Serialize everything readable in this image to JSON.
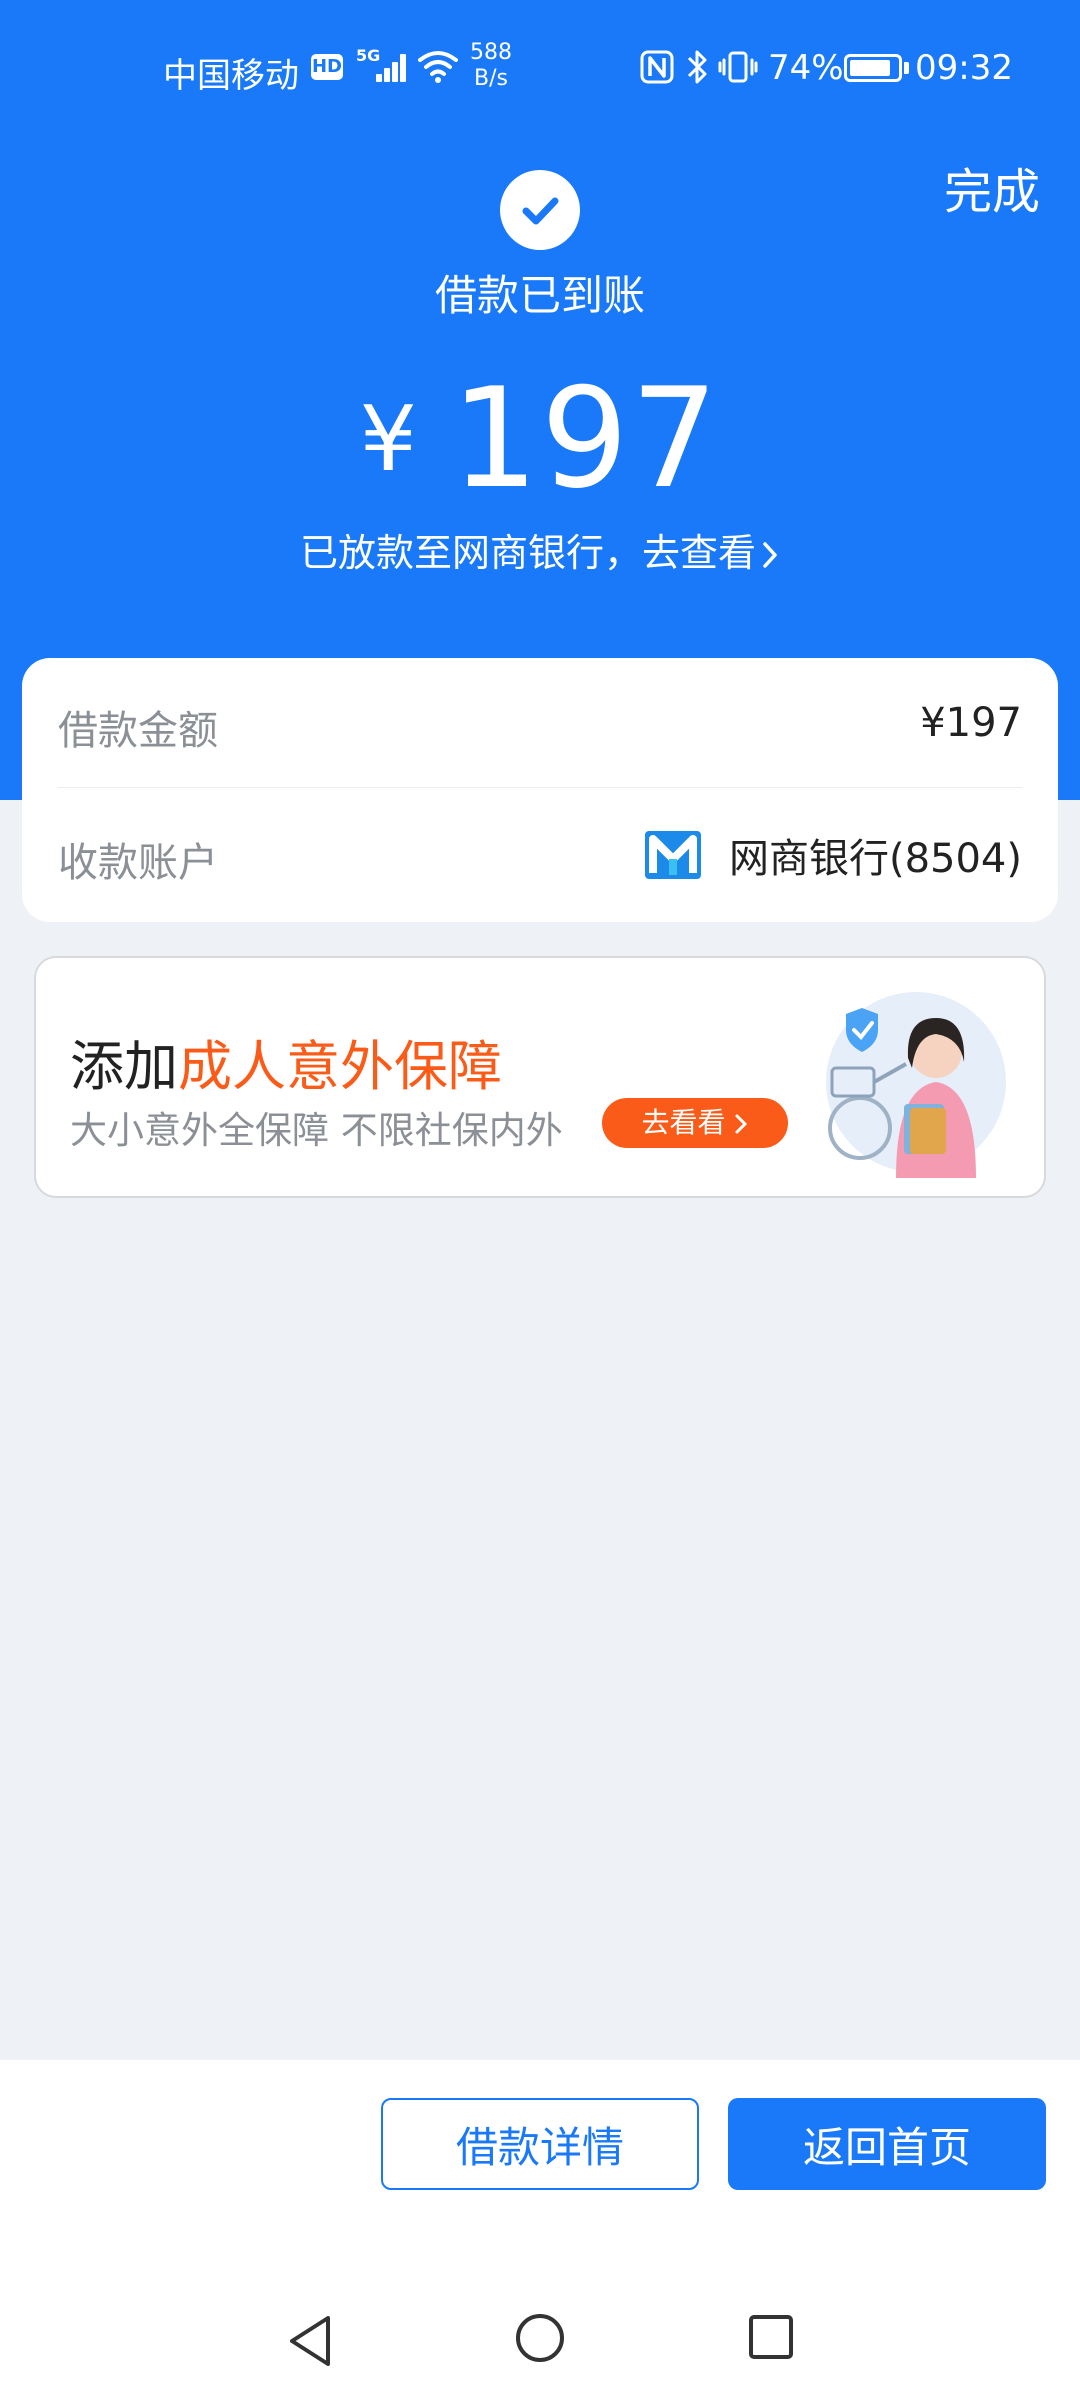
{
  "status_bar": {
    "carrier": "中国移动",
    "hd_badge": "HD",
    "network": "5G",
    "speed_value": "588",
    "speed_unit": "B/s",
    "battery_percent": "74%",
    "time": "09:32"
  },
  "header": {
    "done_label": "完成",
    "status_title": "借款已到账",
    "currency_symbol": "¥",
    "amount": "197",
    "disburse_text": "已放款至网商银行，去查看"
  },
  "info_card": {
    "loan_amount_label": "借款金额",
    "loan_amount_value": "¥197",
    "account_label": "收款账户",
    "account_value": "网商银行(8504)"
  },
  "insurance_banner": {
    "title_prefix": "添加",
    "title_highlight": "成人意外保障",
    "subtitle": "大小意外全保障 不限社保内外",
    "cta_label": "去看看",
    "highlight_color": "#fb5b18"
  },
  "actions": {
    "detail_label": "借款详情",
    "home_label": "返回首页"
  },
  "theme": {
    "primary": "#1a79f8",
    "background": "#eef2f7"
  },
  "icons": {
    "check": "check-icon",
    "bank_logo": "mybank-logo-icon",
    "nav_back": "nav-back-icon",
    "nav_home": "nav-home-icon",
    "nav_recent": "nav-recent-icon"
  }
}
